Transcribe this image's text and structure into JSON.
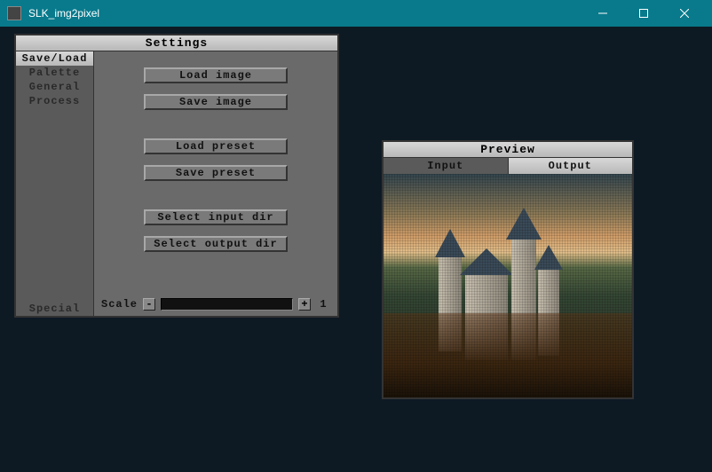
{
  "window": {
    "title": "SLK_img2pixel"
  },
  "settings": {
    "title": "Settings",
    "sidebar": {
      "items": [
        {
          "label": "Save/Load",
          "active": true
        },
        {
          "label": "Palette",
          "active": false
        },
        {
          "label": "General",
          "active": false
        },
        {
          "label": "Process",
          "active": false
        }
      ],
      "bottom_label": "Special"
    },
    "buttons": {
      "load_image": "Load image",
      "save_image": "Save image",
      "load_preset": "Load preset",
      "save_preset": "Save preset",
      "select_input_dir": "Select input dir",
      "select_output_dir": "Select output dir"
    },
    "scale": {
      "label": "Scale",
      "minus": "-",
      "plus": "+",
      "value": "1"
    }
  },
  "preview": {
    "title": "Preview",
    "tabs": {
      "input": "Input",
      "output": "Output"
    }
  }
}
